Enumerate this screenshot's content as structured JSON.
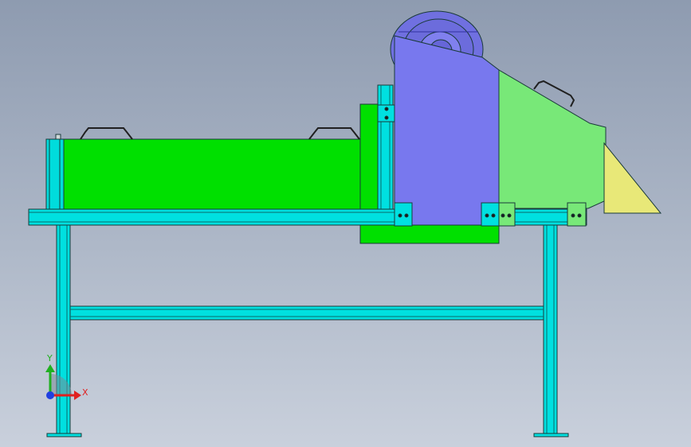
{
  "viewport": {
    "background_top": "#8e9bb0",
    "background_bottom": "#c9d0dc"
  },
  "model": {
    "frame_color": "#00e0e0",
    "frame_edge": "#1a4a4a",
    "hopper_color": "#00e000",
    "housing_color": "#7878ee",
    "chute_color": "#78e878",
    "spout_color": "#e8e878",
    "wheel_color": "#7070e0"
  },
  "triad": {
    "x_label": "X",
    "y_label": "Y",
    "x_color": "#e02020",
    "y_color": "#20b020",
    "z_color": "#2040e0"
  }
}
